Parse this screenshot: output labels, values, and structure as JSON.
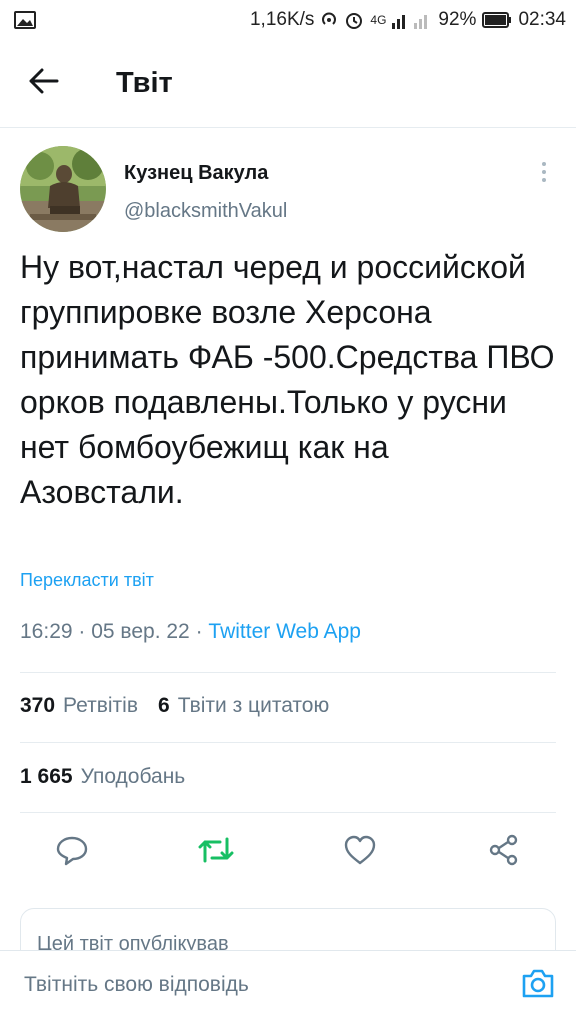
{
  "status_bar": {
    "speed": "1,16K/s",
    "network": "4G",
    "battery": "92%",
    "time": "02:34",
    "icons": [
      "gallery-icon",
      "hotspot-icon",
      "alarm-icon",
      "signal-icon",
      "battery-icon"
    ]
  },
  "header": {
    "title": "Твіт",
    "back_icon": "arrow-left-icon"
  },
  "tweet": {
    "author_name": "Кузнец Вакула",
    "author_handle": "@blacksmithVakul",
    "text": "Ну вот,настал черед и российской группировке возле Херсона принимать ФАБ -500.Средства ПВО орков подавлены.Только у русни нет бомбоубежищ как на Азовстали.",
    "translate_label": "Перекласти твіт",
    "time": "16:29",
    "date": "05 вер. 22",
    "separator": " · ",
    "source": "Twitter Web App"
  },
  "stats": {
    "retweets_count": "370",
    "retweets_label": "Ретвітів",
    "quotes_count": "6",
    "quotes_label": "Твіти з цитатою",
    "likes_count": "1 665",
    "likes_label": "Уподобань"
  },
  "actions": {
    "icons": [
      "reply-icon",
      "retweet-icon",
      "like-icon",
      "share-icon"
    ],
    "retweet_color": "#17bf63"
  },
  "card": {
    "text": "Цей твіт опублікував"
  },
  "reply": {
    "placeholder": "Твітніть свою відповідь",
    "camera_icon": "camera-icon"
  },
  "colors": {
    "accent": "#1da1f2",
    "secondary_text": "#657786",
    "primary_text": "#14171a",
    "retweet": "#17bf63"
  }
}
